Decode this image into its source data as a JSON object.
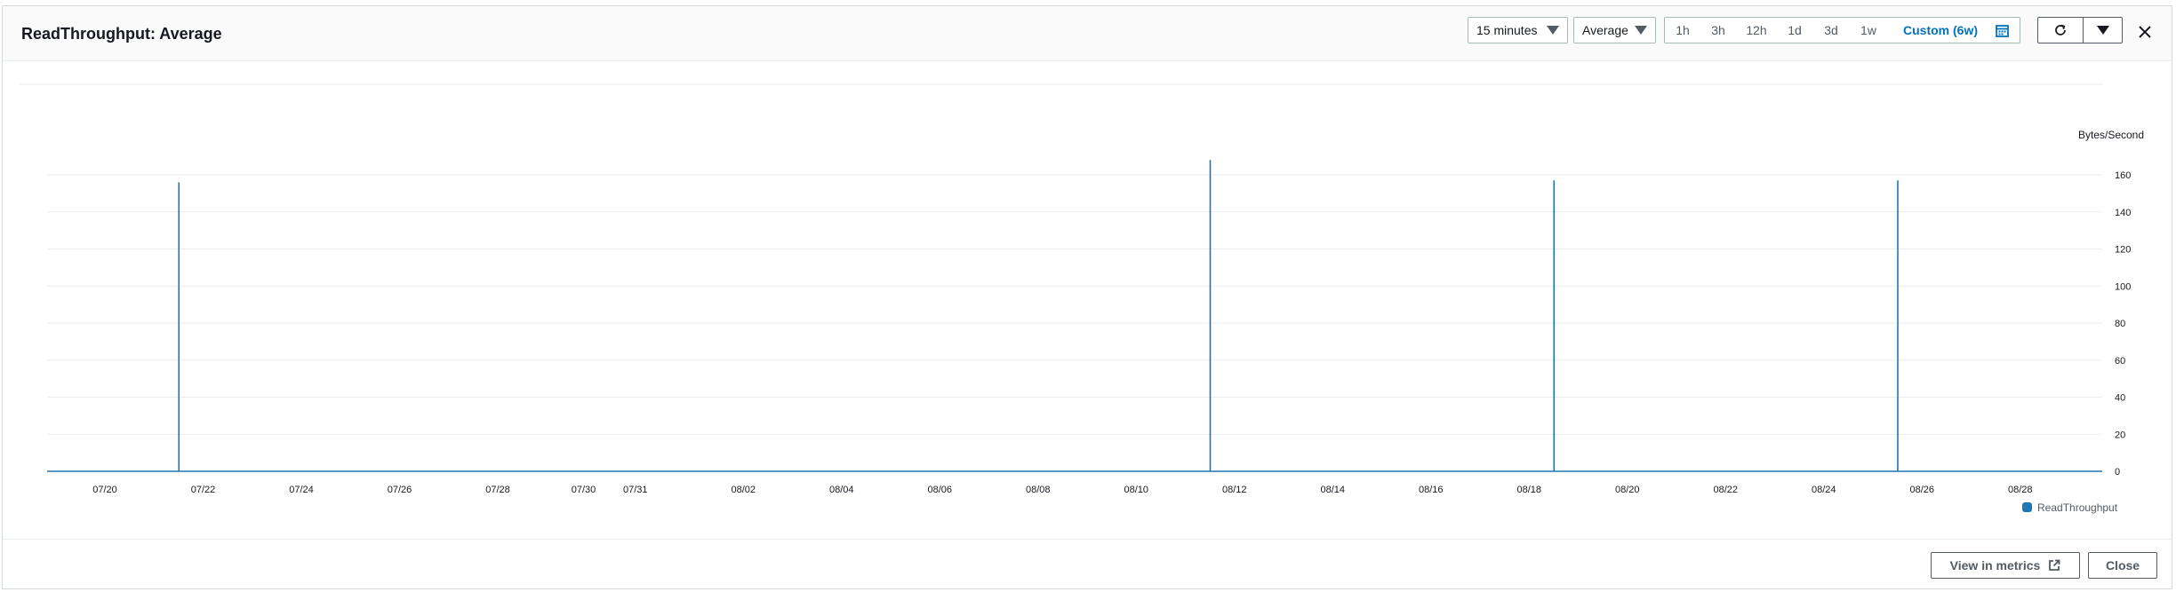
{
  "header": {
    "title": "ReadThroughput: Average",
    "period_select": "15 minutes",
    "stat_select": "Average",
    "ranges": [
      "1h",
      "3h",
      "12h",
      "1d",
      "3d",
      "1w",
      "Custom (6w)"
    ],
    "active_range": "Custom (6w)",
    "icons": {
      "calendar": "calendar-icon",
      "refresh": "refresh-icon",
      "dropdown": "caret-down-icon",
      "close": "close-icon"
    }
  },
  "chart_data": {
    "type": "line",
    "ylabel": "Bytes/Second",
    "ylim": [
      0,
      160
    ],
    "yticks": [
      0,
      20,
      40,
      60,
      80,
      100,
      120,
      140,
      160
    ],
    "xticks": [
      "07/20",
      "07/22",
      "07/24",
      "07/26",
      "07/28",
      "07/30",
      "07/31",
      "08/02",
      "08/04",
      "08/06",
      "08/08",
      "08/10",
      "08/12",
      "08/14",
      "08/16",
      "08/18",
      "08/20",
      "08/22",
      "08/24",
      "08/26",
      "08/28"
    ],
    "grid": true,
    "legend_position": "bottom-right",
    "series": [
      {
        "name": "ReadThroughput",
        "color": "#1f77b4",
        "baseline": 0,
        "spikes": [
          {
            "x": "07/21",
            "y": 156
          },
          {
            "x": "08/11",
            "y": 168
          },
          {
            "x": "08/18",
            "y": 157
          },
          {
            "x": "08/25",
            "y": 157
          }
        ]
      }
    ]
  },
  "footer": {
    "view_in_metrics": "View in metrics",
    "close": "Close"
  }
}
